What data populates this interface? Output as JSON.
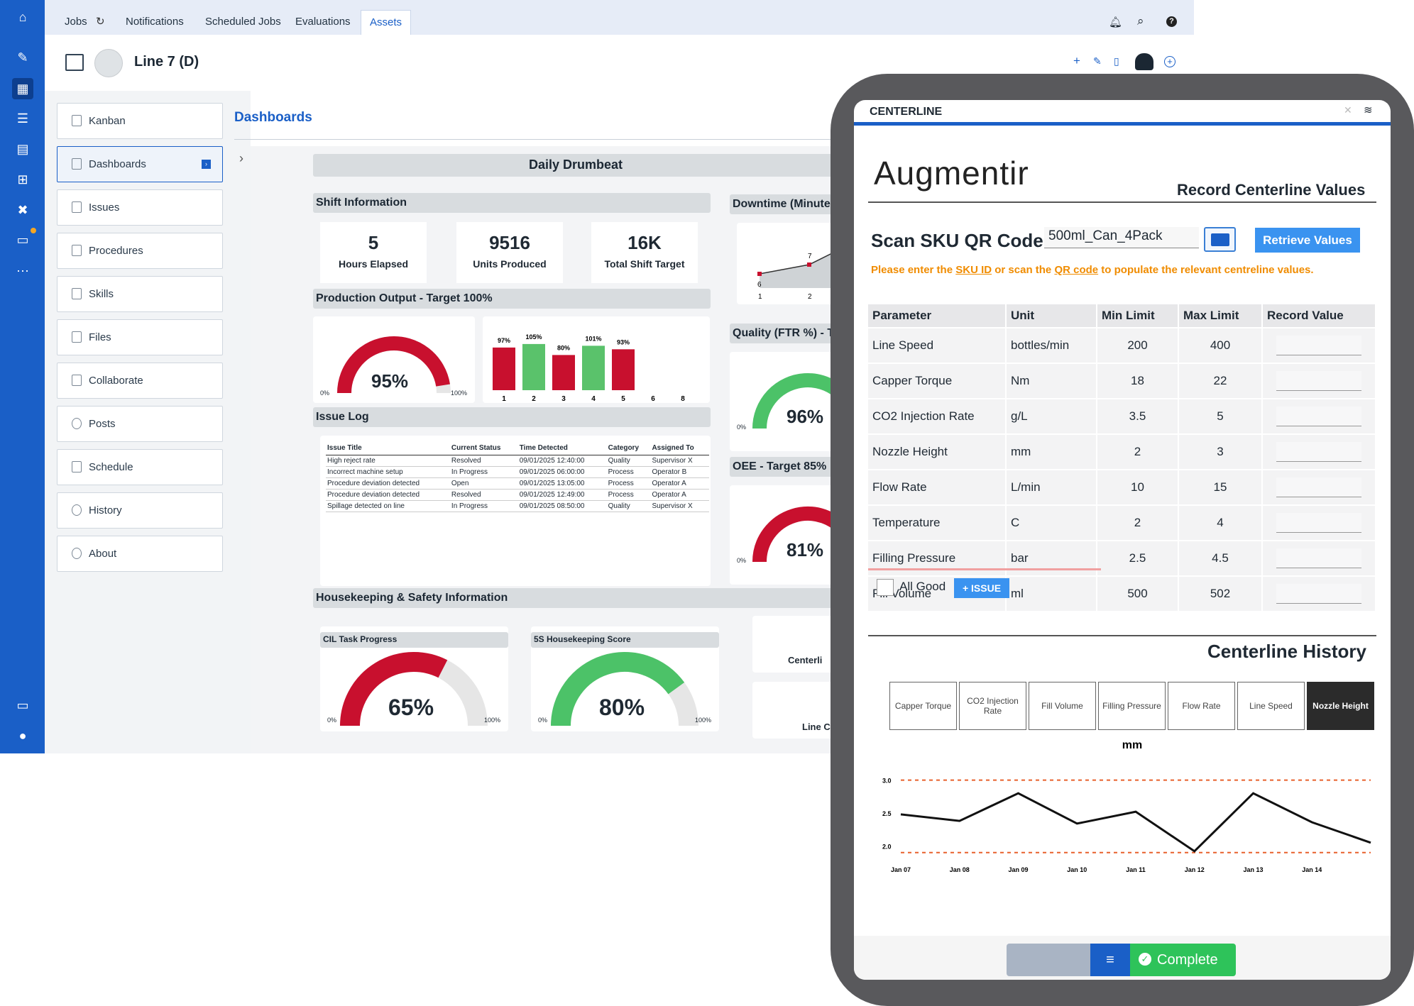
{
  "topbar": {
    "tabs": [
      {
        "label": "Jobs"
      },
      {
        "label": "Notifications"
      },
      {
        "label": "Scheduled Jobs"
      },
      {
        "label": "Evaluations"
      },
      {
        "label": "Assets"
      }
    ]
  },
  "header": {
    "asset_title": "Line 7 (D)"
  },
  "nav": {
    "items": [
      {
        "label": "Kanban"
      },
      {
        "label": "Dashboards"
      },
      {
        "label": "Issues"
      },
      {
        "label": "Procedures"
      },
      {
        "label": "Skills"
      },
      {
        "label": "Files"
      },
      {
        "label": "Collaborate"
      },
      {
        "label": "Posts"
      },
      {
        "label": "Schedule"
      },
      {
        "label": "History"
      },
      {
        "label": "About"
      }
    ]
  },
  "dashboard": {
    "section_title": "Dashboards",
    "title": "Daily Drumbeat",
    "shift": {
      "title": "Shift Information",
      "kpis": [
        {
          "value": "5",
          "label": "Hours Elapsed"
        },
        {
          "value": "9516",
          "label": "Units Produced"
        },
        {
          "value": "16K",
          "label": "Total Shift Target"
        }
      ]
    },
    "downtime": {
      "title": "Downtime (Minute",
      "labels": [
        "6",
        "7",
        "1",
        "2"
      ]
    },
    "production": {
      "title": "Production Output - Target 100%",
      "gauge": {
        "value": "95%",
        "min": "0%",
        "max": "100%",
        "fraction": 0.95
      }
    },
    "quality": {
      "title": "Quality (FTR %) - Ta",
      "gauge": {
        "value": "96%",
        "min": "0%",
        "fraction": 0.96
      }
    },
    "oee": {
      "title": "OEE - Target 85%",
      "gauge": {
        "value": "81%",
        "min": "0%",
        "fraction": 0.81
      }
    },
    "issue_log": {
      "title": "Issue Log",
      "headers": [
        "Issue Title",
        "Current Status",
        "Time Detected",
        "Category",
        "Assigned To"
      ],
      "rows": [
        [
          "High reject rate",
          "Resolved",
          "09/01/2025 12:40:00",
          "Quality",
          "Supervisor X"
        ],
        [
          "Incorrect machine setup",
          "In Progress",
          "09/01/2025 06:00:00",
          "Process",
          "Operator B"
        ],
        [
          "Procedure deviation detected",
          "Open",
          "09/01/2025 13:05:00",
          "Process",
          "Operator A"
        ],
        [
          "Procedure deviation detected",
          "Resolved",
          "09/01/2025 12:49:00",
          "Process",
          "Operator A"
        ],
        [
          "Spillage detected on line",
          "In Progress",
          "09/01/2025 08:50:00",
          "Quality",
          "Supervisor X"
        ]
      ]
    },
    "housekeeping": {
      "title": "Housekeeping & Safety Information",
      "cil": {
        "title": "CIL Task Progress",
        "value": "65%",
        "min": "0%",
        "max": "100%",
        "fraction": 0.65
      },
      "fives": {
        "title": "5S Housekeeping Score",
        "value": "80%",
        "min": "0%",
        "max": "100%",
        "fraction": 0.8
      },
      "cut1": "Centerli",
      "cut2": "Line C"
    }
  },
  "chart_data": [
    {
      "type": "bar",
      "categories": [
        "1",
        "2",
        "3",
        "4",
        "5",
        "6",
        "8"
      ],
      "values": [
        97,
        105,
        80,
        101,
        93,
        null,
        null
      ],
      "labels": [
        "97%",
        "105%",
        "80%",
        "101%",
        "93%",
        "",
        ""
      ],
      "colors": [
        "#c8102e",
        "#5ac26b",
        "#c8102e",
        "#5ac26b",
        "#c8102e"
      ]
    },
    {
      "type": "line",
      "title": "mm",
      "x": [
        "Jan 07",
        "Jan 08",
        "Jan 09",
        "Jan 10",
        "Jan 11",
        "Jan 12",
        "Jan 13",
        "Jan 14",
        ""
      ],
      "y": [
        2.48,
        2.38,
        2.8,
        2.34,
        2.52,
        1.92,
        2.8,
        2.36,
        2.05
      ],
      "yticks": [
        "3.0",
        "2.5",
        "2.0"
      ],
      "ylim": [
        1.8,
        3.2
      ],
      "limits": [
        3.0,
        1.9
      ]
    }
  ],
  "tablet": {
    "header": "CENTERLINE",
    "logo": "Augmentir",
    "heading": "Record Centerline Values",
    "scan_label": "Scan SKU QR Code:",
    "scan_value": "500ml_Can_4Pack",
    "retrieve_button": "Retrieve Values",
    "hint_pre": "Please enter the ",
    "hint_sku": "SKU ID",
    "hint_mid": " or scan the ",
    "hint_qr": "QR code",
    "hint_post": " to populate the relevant centreline values.",
    "table": {
      "headers": [
        "Parameter",
        "Unit",
        "Min Limit",
        "Max Limit",
        "Record Value"
      ],
      "rows": [
        [
          "Line Speed",
          "bottles/min",
          "200",
          "400"
        ],
        [
          "Capper Torque",
          "Nm",
          "18",
          "22"
        ],
        [
          "CO2 Injection Rate",
          "g/L",
          "3.5",
          "5"
        ],
        [
          "Nozzle Height",
          "mm",
          "2",
          "3"
        ],
        [
          "Flow Rate",
          "L/min",
          "10",
          "15"
        ],
        [
          "Temperature",
          "C",
          "2",
          "4"
        ],
        [
          "Filling Pressure",
          "bar",
          "2.5",
          "4.5"
        ],
        [
          "Fill Volume",
          "ml",
          "500",
          "502"
        ]
      ]
    },
    "all_good": "All Good",
    "issue_button": "+ ISSUE",
    "history_title": "Centerline History",
    "history_tabs": [
      "Capper Torque",
      "CO2 Injection Rate",
      "Fill Volume",
      "Filling Pressure",
      "Flow Rate",
      "Line Speed",
      "Nozzle Height"
    ],
    "complete": "Complete"
  }
}
